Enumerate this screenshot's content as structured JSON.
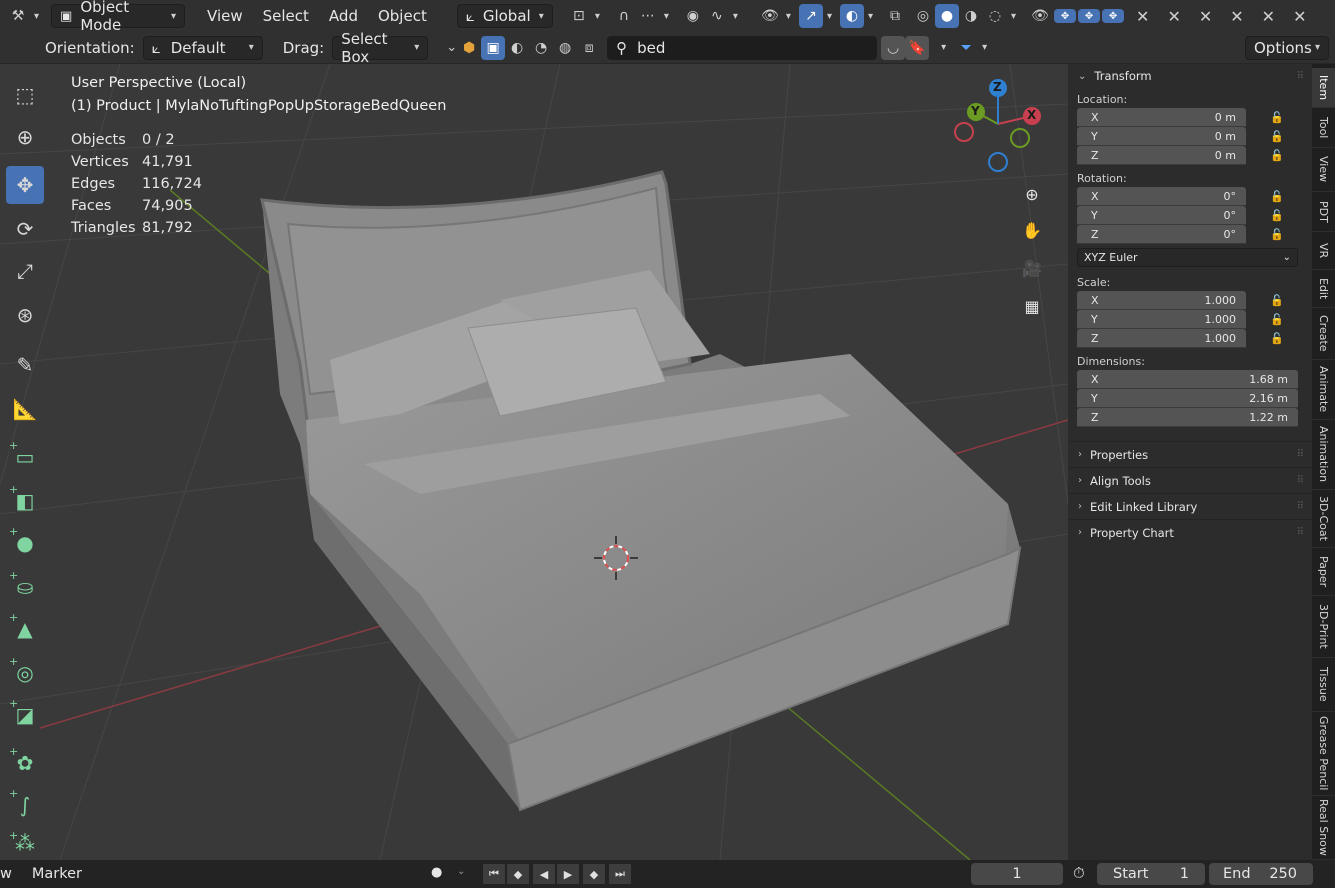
{
  "header": {
    "mode": "Object Mode",
    "menus": [
      "View",
      "Select",
      "Add",
      "Object"
    ],
    "transform_orientation": "Global",
    "overlay_badges": [
      "✥",
      "✥",
      "✥"
    ]
  },
  "tool_header": {
    "orientation_label": "Orientation:",
    "orientation_value": "Default",
    "drag_label": "Drag:",
    "drag_value": "Select Box",
    "search_value": "bed",
    "options_label": "Options"
  },
  "viewport": {
    "perspective": "User Perspective (Local)",
    "object_path": "(1) Product | MylaNoTuftingPopUpStorageBedQueen",
    "stats": [
      {
        "label": "Objects",
        "value": "0 / 2"
      },
      {
        "label": "Vertices",
        "value": "41,791"
      },
      {
        "label": "Edges",
        "value": "116,724"
      },
      {
        "label": "Faces",
        "value": "74,905"
      },
      {
        "label": "Triangles",
        "value": "81,792"
      }
    ],
    "gizmo_axes": {
      "x": "X",
      "y": "Y",
      "z": "Z"
    },
    "colors": {
      "x_axis": "#c8404f",
      "y_axis": "#6b9b22",
      "z_axis": "#2f7fd1",
      "accent": "#4772b3"
    }
  },
  "sidebar": {
    "transform_title": "Transform",
    "location_label": "Location:",
    "location": [
      {
        "axis": "X",
        "value": "0 m"
      },
      {
        "axis": "Y",
        "value": "0 m"
      },
      {
        "axis": "Z",
        "value": "0 m"
      }
    ],
    "rotation_label": "Rotation:",
    "rotation": [
      {
        "axis": "X",
        "value": "0°"
      },
      {
        "axis": "Y",
        "value": "0°"
      },
      {
        "axis": "Z",
        "value": "0°"
      }
    ],
    "rotation_mode": "XYZ Euler",
    "scale_label": "Scale:",
    "scale": [
      {
        "axis": "X",
        "value": "1.000"
      },
      {
        "axis": "Y",
        "value": "1.000"
      },
      {
        "axis": "Z",
        "value": "1.000"
      }
    ],
    "dimensions_label": "Dimensions:",
    "dimensions": [
      {
        "axis": "X",
        "value": "1.68 m"
      },
      {
        "axis": "Y",
        "value": "2.16 m"
      },
      {
        "axis": "Z",
        "value": "1.22 m"
      }
    ],
    "subpanels": [
      "Properties",
      "Align Tools",
      "Edit Linked Library",
      "Property Chart"
    ]
  },
  "tabs": [
    "Item",
    "Tool",
    "View",
    "PDT",
    "VR",
    "Edit",
    "Create",
    "Animate",
    "Animation",
    "3D-Coat",
    "Paper",
    "3D-Print",
    "Tissue",
    "Grease Pencil",
    "Real Snow"
  ],
  "timeline": {
    "view_label": "w",
    "marker_label": "Marker",
    "current_frame": "1",
    "start_label": "Start",
    "start_value": "1",
    "end_label": "End",
    "end_value": "250"
  }
}
